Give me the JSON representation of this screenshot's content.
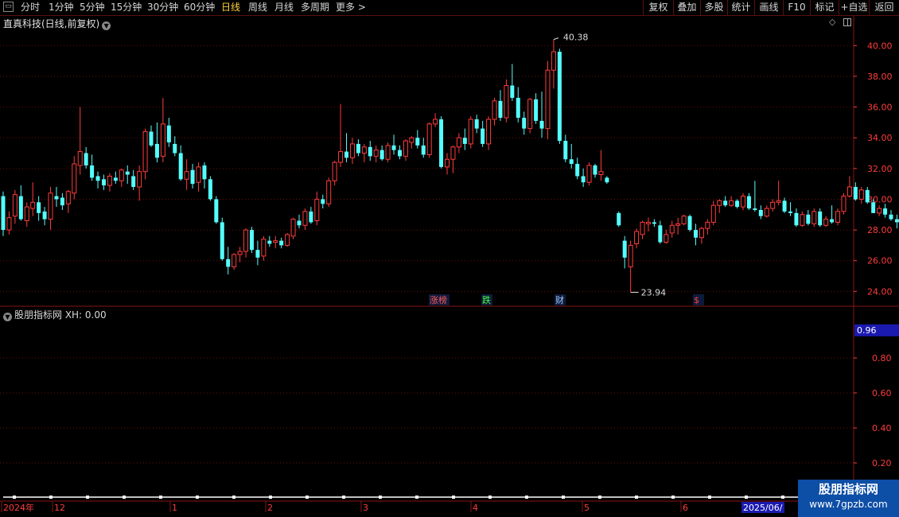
{
  "toolbar": {
    "tabs": [
      "分时",
      "1分钟",
      "5分钟",
      "15分钟",
      "30分钟",
      "60分钟",
      "日线",
      "周线",
      "月线",
      "多周期",
      "更多 >"
    ],
    "active_tab": "日线",
    "right_buttons": [
      "复权",
      "叠加",
      "多股",
      "统计",
      "画线",
      "F10",
      "标记",
      "+自选",
      "返回"
    ]
  },
  "main_chart": {
    "title": "直真科技(日线,前复权)",
    "price_labels": {
      "high": "40.38",
      "low": "23.94"
    },
    "event_markers": [
      {
        "text": "涨榜",
        "color": "#ff5a5a"
      },
      {
        "text": "跌",
        "color": "#44ff44"
      },
      {
        "text": "财",
        "color": "#9ecbff"
      },
      {
        "text": "$",
        "color": "#ff4444"
      }
    ]
  },
  "sub_chart": {
    "title": "股朋指标网 XH: 0.00",
    "current_value": "0.96"
  },
  "x_axis": {
    "labels": [
      "2024年",
      "12",
      "1",
      "2",
      "3",
      "4",
      "5",
      "6",
      "2025/06/"
    ]
  },
  "watermark": {
    "line1": "股朋指标网",
    "line2": "www.7gpzb.com"
  },
  "colors": {
    "up": "#ff3c3c",
    "down": "#54ffff",
    "grid": "#6a0d0d",
    "axis_text": "#ff3c3c",
    "indicator_line": "#ffffff"
  },
  "chart_data": {
    "type": "candlestick",
    "y_axis": {
      "min": 23.5,
      "max": 41.0,
      "ticks": [
        24,
        26,
        28,
        30,
        32,
        34,
        36,
        38,
        40
      ]
    },
    "sub_y_axis": {
      "min": 0,
      "max": 1.0,
      "ticks": [
        0.2,
        0.4,
        0.6,
        0.8
      ]
    },
    "ohlc": [
      [
        30.2,
        30.5,
        27.6,
        28.0
      ],
      [
        28.0,
        29.2,
        27.7,
        28.8
      ],
      [
        28.9,
        30.6,
        28.4,
        30.3
      ],
      [
        30.2,
        30.9,
        28.6,
        28.7
      ],
      [
        28.6,
        29.8,
        28.2,
        29.5
      ],
      [
        29.4,
        31.1,
        28.9,
        29.8
      ],
      [
        29.8,
        30.2,
        28.6,
        29.1
      ],
      [
        29.2,
        29.5,
        28.3,
        28.7
      ],
      [
        28.7,
        30.8,
        28.0,
        30.4
      ],
      [
        30.2,
        30.8,
        29.5,
        30.0
      ],
      [
        30.1,
        30.4,
        29.3,
        29.6
      ],
      [
        29.7,
        30.6,
        29.1,
        30.5
      ],
      [
        30.4,
        32.8,
        30.0,
        32.3
      ],
      [
        32.2,
        36.0,
        31.6,
        33.1
      ],
      [
        33.0,
        33.4,
        32.0,
        32.2
      ],
      [
        32.2,
        32.9,
        31.2,
        31.4
      ],
      [
        31.5,
        31.8,
        30.7,
        31.2
      ],
      [
        31.3,
        31.6,
        30.6,
        30.9
      ],
      [
        30.9,
        31.7,
        30.5,
        31.5
      ],
      [
        31.4,
        31.8,
        31.0,
        31.2
      ],
      [
        31.2,
        32.0,
        30.8,
        31.9
      ],
      [
        31.8,
        32.2,
        31.0,
        31.6
      ],
      [
        31.5,
        31.9,
        30.6,
        30.8
      ],
      [
        30.8,
        32.2,
        29.9,
        31.8
      ],
      [
        31.8,
        34.6,
        31.3,
        34.4
      ],
      [
        34.4,
        34.8,
        33.4,
        33.5
      ],
      [
        33.6,
        35.0,
        32.4,
        32.7
      ],
      [
        32.8,
        36.6,
        32.4,
        34.9
      ],
      [
        34.8,
        35.3,
        33.4,
        33.7
      ],
      [
        33.6,
        34.1,
        32.8,
        33.0
      ],
      [
        33.0,
        33.5,
        31.2,
        31.3
      ],
      [
        31.3,
        32.6,
        30.6,
        31.8
      ],
      [
        31.9,
        32.3,
        30.7,
        31.0
      ],
      [
        31.1,
        32.4,
        30.5,
        32.1
      ],
      [
        32.2,
        32.4,
        30.7,
        31.3
      ],
      [
        31.3,
        31.5,
        29.9,
        30.0
      ],
      [
        30.0,
        30.2,
        28.4,
        28.5
      ],
      [
        28.5,
        28.8,
        26.0,
        26.1
      ],
      [
        26.1,
        26.9,
        25.1,
        25.6
      ],
      [
        25.6,
        26.5,
        25.4,
        26.4
      ],
      [
        26.4,
        26.9,
        25.9,
        26.6
      ],
      [
        26.6,
        28.1,
        26.2,
        28.0
      ],
      [
        28.0,
        28.2,
        26.5,
        26.7
      ],
      [
        26.7,
        27.3,
        25.7,
        26.2
      ],
      [
        26.3,
        27.6,
        26.0,
        27.4
      ],
      [
        27.3,
        27.6,
        26.9,
        27.1
      ],
      [
        27.2,
        27.6,
        26.8,
        27.3
      ],
      [
        27.3,
        27.5,
        26.8,
        27.0
      ],
      [
        27.0,
        27.8,
        26.9,
        27.7
      ],
      [
        27.6,
        28.8,
        27.4,
        28.7
      ],
      [
        28.6,
        29.0,
        28.1,
        28.3
      ],
      [
        28.3,
        29.4,
        28.0,
        29.2
      ],
      [
        29.2,
        29.5,
        28.4,
        28.5
      ],
      [
        28.6,
        30.5,
        28.3,
        30.0
      ],
      [
        30.0,
        30.3,
        29.4,
        29.7
      ],
      [
        29.7,
        31.4,
        29.5,
        31.2
      ],
      [
        31.2,
        32.5,
        30.9,
        32.4
      ],
      [
        32.4,
        36.2,
        32.1,
        33.1
      ],
      [
        33.1,
        34.3,
        32.4,
        32.7
      ],
      [
        32.7,
        34.0,
        32.3,
        33.6
      ],
      [
        33.6,
        33.9,
        32.8,
        33.0
      ],
      [
        33.0,
        33.6,
        32.4,
        33.4
      ],
      [
        33.4,
        33.8,
        32.5,
        32.8
      ],
      [
        32.8,
        33.5,
        32.4,
        33.2
      ],
      [
        33.2,
        33.5,
        32.5,
        32.6
      ],
      [
        32.6,
        33.7,
        32.4,
        33.5
      ],
      [
        33.5,
        34.2,
        32.9,
        33.2
      ],
      [
        33.2,
        33.5,
        32.6,
        32.8
      ],
      [
        32.8,
        33.9,
        32.5,
        33.8
      ],
      [
        33.7,
        34.1,
        33.3,
        34.0
      ],
      [
        34.0,
        34.5,
        33.3,
        33.5
      ],
      [
        33.5,
        34.0,
        32.7,
        32.9
      ],
      [
        32.9,
        35.0,
        32.7,
        34.9
      ],
      [
        34.9,
        35.6,
        34.7,
        35.2
      ],
      [
        35.2,
        35.4,
        32.0,
        32.1
      ],
      [
        32.1,
        33.0,
        31.6,
        32.6
      ],
      [
        32.6,
        33.5,
        31.7,
        33.4
      ],
      [
        33.4,
        34.3,
        33.0,
        34.0
      ],
      [
        34.0,
        34.6,
        33.2,
        33.6
      ],
      [
        33.6,
        35.4,
        33.3,
        35.2
      ],
      [
        35.2,
        35.5,
        34.3,
        34.6
      ],
      [
        34.6,
        35.1,
        33.4,
        33.6
      ],
      [
        33.6,
        35.4,
        33.2,
        35.2
      ],
      [
        35.2,
        36.6,
        34.8,
        36.4
      ],
      [
        36.4,
        37.1,
        35.1,
        35.3
      ],
      [
        35.3,
        37.8,
        35.0,
        37.4
      ],
      [
        37.4,
        38.8,
        36.4,
        36.6
      ],
      [
        36.6,
        37.3,
        35.0,
        35.3
      ],
      [
        35.3,
        35.7,
        34.2,
        34.6
      ],
      [
        34.6,
        36.6,
        34.3,
        36.5
      ],
      [
        36.5,
        36.9,
        34.9,
        35.1
      ],
      [
        35.1,
        37.0,
        34.0,
        34.6
      ],
      [
        34.6,
        39.0,
        33.9,
        38.4
      ],
      [
        38.4,
        40.4,
        37.2,
        39.6
      ],
      [
        39.6,
        39.8,
        33.6,
        33.8
      ],
      [
        33.8,
        34.2,
        32.4,
        32.6
      ],
      [
        32.6,
        33.6,
        32.0,
        32.3
      ],
      [
        32.3,
        32.7,
        31.3,
        31.5
      ],
      [
        31.5,
        32.0,
        30.8,
        31.1
      ],
      [
        31.1,
        32.4,
        30.9,
        32.2
      ],
      [
        32.2,
        32.3,
        31.4,
        31.6
      ],
      [
        31.6,
        33.2,
        31.2,
        31.8
      ],
      [
        31.4,
        31.5,
        31.0,
        31.1
      ]
    ],
    "ohlc_after_gap": [
      [
        29.1,
        29.2,
        28.2,
        28.3
      ],
      [
        27.3,
        27.6,
        25.5,
        26.2
      ],
      [
        25.6,
        27.3,
        23.94,
        27.0
      ],
      [
        27.1,
        28.1,
        26.8,
        27.9
      ],
      [
        27.7,
        28.6,
        27.4,
        28.5
      ],
      [
        28.4,
        28.8,
        27.9,
        28.5
      ],
      [
        28.5,
        28.7,
        28.2,
        28.4
      ],
      [
        28.3,
        28.6,
        27.1,
        27.2
      ],
      [
        27.2,
        28.0,
        27.1,
        27.7
      ],
      [
        27.8,
        28.6,
        27.5,
        28.3
      ],
      [
        28.3,
        28.8,
        27.7,
        28.4
      ],
      [
        28.4,
        29.0,
        28.3,
        28.9
      ],
      [
        28.9,
        29.0,
        27.9,
        28.0
      ],
      [
        28.0,
        28.4,
        27.0,
        27.5
      ],
      [
        27.5,
        28.2,
        27.1,
        28.1
      ],
      [
        28.1,
        28.7,
        27.7,
        28.5
      ],
      [
        28.5,
        29.9,
        28.3,
        29.6
      ],
      [
        29.6,
        30.0,
        29.1,
        29.9
      ],
      [
        29.9,
        30.2,
        29.5,
        29.6
      ],
      [
        29.6,
        30.2,
        29.5,
        29.9
      ],
      [
        29.9,
        30.0,
        29.4,
        29.5
      ],
      [
        29.5,
        30.4,
        29.3,
        30.2
      ],
      [
        30.2,
        30.4,
        29.3,
        29.4
      ],
      [
        29.4,
        31.2,
        29.2,
        29.3
      ],
      [
        29.3,
        29.6,
        28.7,
        28.9
      ],
      [
        28.9,
        29.6,
        28.8,
        29.4
      ],
      [
        29.4,
        30.0,
        29.2,
        29.8
      ],
      [
        29.8,
        31.2,
        29.6,
        29.9
      ],
      [
        29.9,
        30.1,
        29.1,
        29.2
      ],
      [
        29.2,
        29.8,
        28.9,
        29.1
      ],
      [
        29.1,
        29.4,
        28.2,
        28.3
      ],
      [
        28.3,
        29.2,
        28.2,
        29.0
      ],
      [
        29.0,
        29.3,
        28.3,
        28.4
      ],
      [
        28.4,
        29.4,
        28.2,
        29.2
      ],
      [
        29.2,
        29.4,
        28.2,
        28.3
      ],
      [
        28.3,
        28.9,
        28.2,
        28.7
      ],
      [
        28.7,
        29.6,
        28.4,
        28.5
      ],
      [
        28.5,
        29.4,
        28.3,
        29.2
      ],
      [
        29.2,
        30.4,
        29.0,
        30.2
      ],
      [
        30.2,
        31.5,
        30.1,
        30.8
      ],
      [
        30.8,
        31.1,
        29.9,
        30.0
      ],
      [
        30.0,
        30.8,
        29.7,
        30.6
      ],
      [
        30.6,
        30.8,
        29.7,
        29.8
      ],
      [
        29.8,
        30.0,
        29.1,
        29.1
      ],
      [
        29.1,
        29.6,
        28.9,
        29.4
      ],
      [
        29.4,
        29.7,
        28.8,
        29.0
      ],
      [
        29.0,
        29.3,
        28.6,
        28.7
      ],
      [
        28.7,
        29.0,
        28.1,
        28.5
      ],
      [
        28.5,
        29.3,
        28.4,
        29.2
      ],
      [
        29.2,
        30.4,
        29.0,
        30.2
      ],
      [
        30.2,
        31.0,
        30.0,
        30.8
      ],
      [
        30.8,
        31.7,
        29.9,
        30.0
      ],
      [
        30.0,
        30.6,
        29.8,
        30.3
      ],
      [
        30.3,
        30.5,
        29.6,
        29.7
      ],
      [
        29.7,
        30.2,
        29.4,
        29.9
      ],
      [
        29.9,
        30.0,
        29.1,
        29.4
      ],
      [
        29.4,
        30.1,
        29.2,
        30.0
      ],
      [
        30.0,
        30.2,
        29.5,
        29.6
      ],
      [
        29.6,
        30.4,
        29.5,
        30.2
      ],
      [
        30.2,
        30.3,
        29.7,
        30.0
      ],
      [
        30.0,
        30.2,
        29.6,
        30.1
      ],
      [
        30.1,
        30.3,
        29.8,
        29.9
      ],
      [
        29.9,
        30.2,
        29.2,
        29.6
      ]
    ],
    "xh_series": {
      "values_before": 0.0,
      "spike_index_in_after_gap": 51,
      "spike_value": 0.96
    }
  }
}
